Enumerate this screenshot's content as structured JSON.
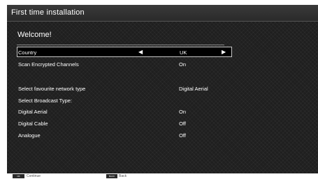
{
  "title": "First time installation",
  "welcome": "Welcome!",
  "rows": [
    {
      "label": "Country",
      "value": "UK",
      "left_arrow": "◀",
      "right_arrow": "▶"
    },
    {
      "label": "Scan Encrypted Channels",
      "value": "On"
    },
    {
      "label": "Select favourite network type",
      "value": "Digital Aerial"
    },
    {
      "label": "Select Broadcast Type:",
      "value": ""
    },
    {
      "label": "Digital Aerial",
      "value": "On"
    },
    {
      "label": "Digital Cable",
      "value": "Off"
    },
    {
      "label": "Analogue",
      "value": "Off"
    }
  ],
  "footer": {
    "continue_key": "OK",
    "continue_label": "Continue",
    "back_key": "BACK",
    "back_label": "Back"
  }
}
